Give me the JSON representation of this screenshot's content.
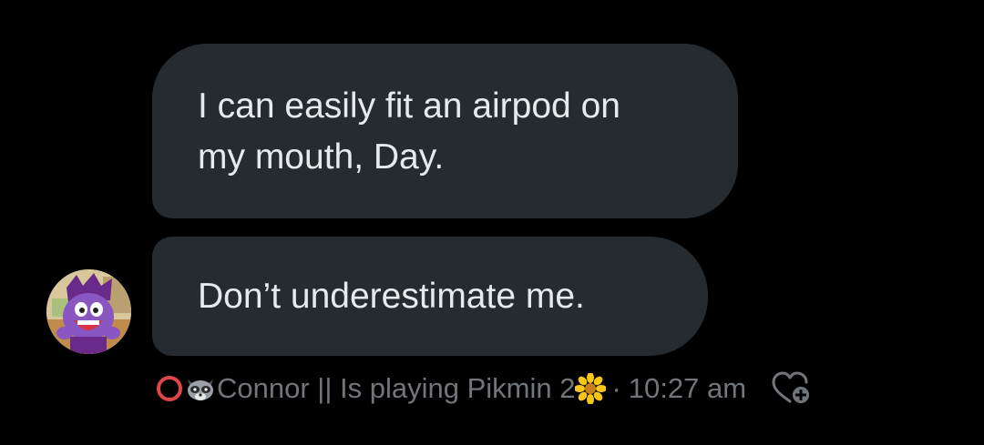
{
  "messages": [
    {
      "lines": [
        "I can easily fit an airpod on",
        "my mouth, Day."
      ]
    },
    {
      "lines": [
        "Don’t underestimate me."
      ]
    }
  ],
  "sender": {
    "avatar_icon": "purple-cartoon-character-avatar",
    "name": "Connor || Is playing Pikmin 2",
    "name_prefix_icons": [
      "red-circle-icon",
      "raccoon-icon"
    ],
    "name_suffix_icon": "sunflower-icon"
  },
  "meta": {
    "separator": "·",
    "time": "10:27 am",
    "reaction_icon": "heart-plus-icon"
  },
  "colors": {
    "background": "#000000",
    "bubble": "#262b30",
    "bubble_text": "#e7e9ea",
    "meta_text": "#71767b"
  }
}
